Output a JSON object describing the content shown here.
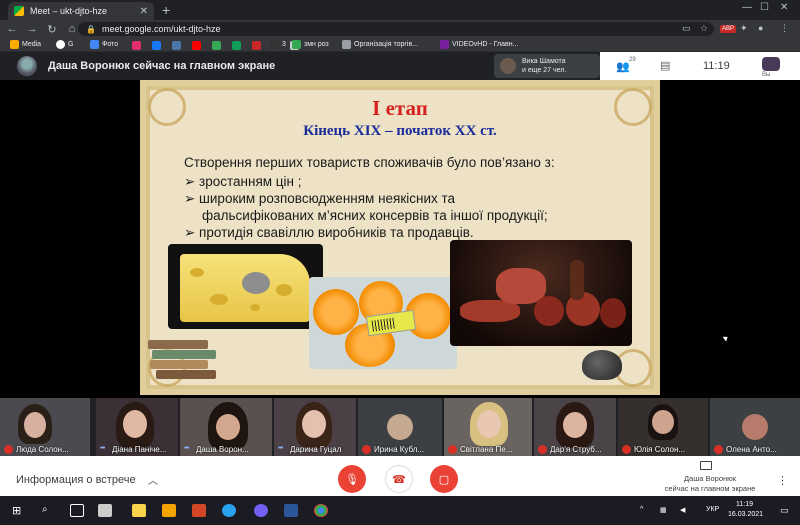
{
  "browser": {
    "tab_title": "Meet – ukt-djto-hze",
    "url": "meet.google.com/ukt-djto-hze",
    "abp": "ABP",
    "bookmarks": [
      "Media",
      "G",
      "Фото",
      "змн роз",
      "Організація торгів...",
      "VIDEOvHD - Главн..."
    ],
    "bookmark_counter": "3"
  },
  "meet": {
    "presenter_banner": "Даша Воронюк сейчас на главном экране",
    "viewer_name": "Вика Шамота",
    "viewer_others": "и еще 27 чел.",
    "people_count": "29",
    "time": "11:19",
    "self_label": "Вы"
  },
  "slide": {
    "title": "І етап",
    "subtitle": "Кінець XIX – початок XX ст.",
    "intro": "Створення перших товариств споживачів було пов’язано з:",
    "bullets": [
      "➢ зростанням цін ;",
      "➢ широким розповсюдженням неякісних та",
      "фальсифікованих м’ясних консервів та іншої продукції;",
      "➢ протидія свавіллю виробників та продавців."
    ]
  },
  "participants": [
    {
      "name": "Люда Солон...",
      "mic": "muted"
    },
    {
      "name": "Діана Паніче...",
      "mic": "active"
    },
    {
      "name": "Даша Ворон...",
      "mic": "active"
    },
    {
      "name": "Дарина Гуцал",
      "mic": "active"
    },
    {
      "name": "Ирина Кубл...",
      "mic": "muted"
    },
    {
      "name": "Світлана Пе...",
      "mic": "muted"
    },
    {
      "name": "Дар'я Струб...",
      "mic": "muted"
    },
    {
      "name": "Юлія Солон...",
      "mic": "muted"
    },
    {
      "name": "Олена Анто...",
      "mic": "muted"
    }
  ],
  "controls": {
    "meeting_info": "Информация о встрече",
    "presenting_line1": "Даша Воронюк",
    "presenting_line2": "сейчас на главном экране"
  },
  "taskbar": {
    "lang": "УКР",
    "time": "11:19",
    "date": "16.03.2021"
  },
  "colors": {
    "slide_title": "#d62020",
    "slide_subtitle": "#1a2c9a",
    "meet_red": "#ea4335"
  }
}
